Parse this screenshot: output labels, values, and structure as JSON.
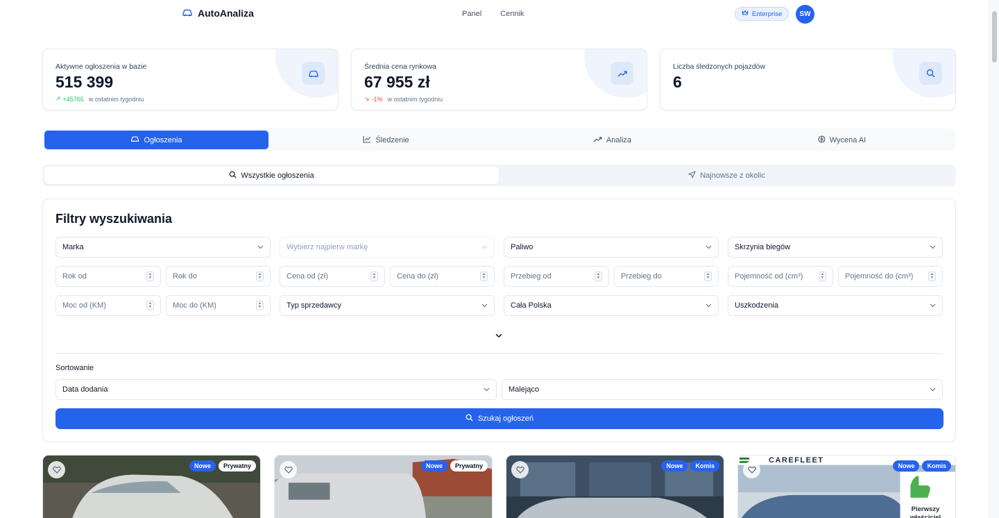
{
  "header": {
    "brand": "AutoAnaliza",
    "nav": [
      "Panel",
      "Cennik"
    ],
    "plan": "Enterprise",
    "avatar_initials": "SW"
  },
  "stats": [
    {
      "label": "Aktywne ogłoszenia w bazie",
      "value": "515 399",
      "delta": "+45765",
      "delta_suffix": "w ostatnim tygodniu",
      "trend": "up",
      "icon": "car-icon"
    },
    {
      "label": "Średnia cena rynkowa",
      "value": "67 955 zł",
      "delta": "-1%",
      "delta_suffix": "w ostatnim tygodniu",
      "trend": "down",
      "icon": "trending-up-icon"
    },
    {
      "label": "Liczba śledzonych pojazdów",
      "value": "6",
      "icon": "search-icon"
    }
  ],
  "main_tabs": [
    "Ogłoszenia",
    "Śledzenie",
    "Analiza",
    "Wycena AI"
  ],
  "sub_tabs": [
    "Wszystkie ogłoszenia",
    "Najnowsze z okolic"
  ],
  "filters": {
    "title": "Filtry wyszukiwania",
    "brand": "Marka",
    "model_placeholder": "Wybierz najpierw markę",
    "fuel": "Paliwo",
    "gearbox": "Skrzynia biegów",
    "year_from": "Rok od",
    "year_to": "Rok do",
    "price_from": "Cena od (zł)",
    "price_to": "Cena do (zł)",
    "mileage_from": "Przebieg od",
    "mileage_to": "Przebieg do",
    "capacity_from": "Pojemność od (cm³)",
    "capacity_to": "Pojemność do (cm³)",
    "power_from": "Moc od (KM)",
    "power_to": "Moc do (KM)",
    "seller_type": "Typ sprzedawcy",
    "region": "Cała Polska",
    "damage": "Uszkodzenia",
    "sort_label": "Sortowanie",
    "sort_field": "Data dodania",
    "sort_order": "Malejąco",
    "search_button": "Szukaj ogłoszeń"
  },
  "listings": [
    {
      "badges": [
        "Nowe",
        "Prywatny"
      ]
    },
    {
      "badges": [
        "Nowe",
        "Prywatny"
      ]
    },
    {
      "badges": [
        "Nowe",
        "Komis"
      ]
    },
    {
      "badges": [
        "Nowe",
        "Komis"
      ],
      "watermark": "CAREFLEET",
      "overlay_text": "Pierwszy właściciel"
    }
  ],
  "colors": {
    "accent": "#2563eb",
    "up": "#22c55e",
    "down": "#ef4444"
  }
}
